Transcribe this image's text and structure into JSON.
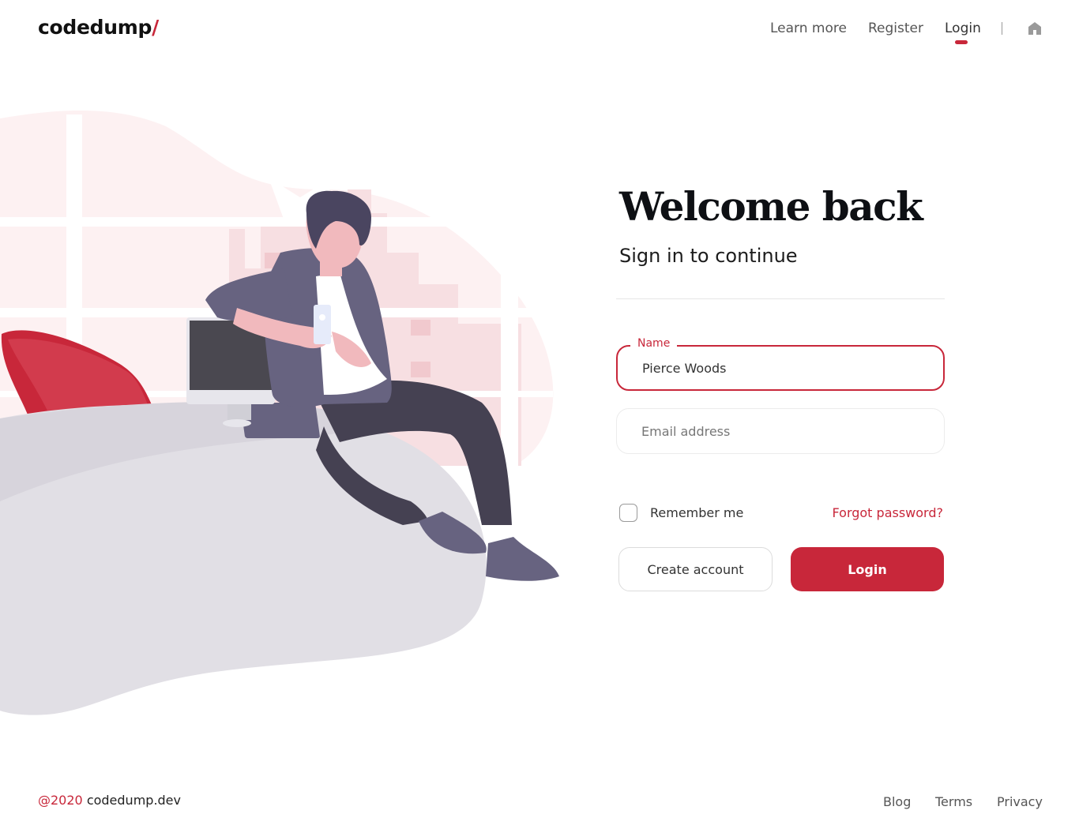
{
  "brand": {
    "name": "codedump",
    "slash": "/"
  },
  "nav": {
    "items": [
      {
        "label": "Learn more"
      },
      {
        "label": "Register"
      },
      {
        "label": "Login"
      }
    ],
    "active": "Login"
  },
  "form": {
    "title": "Welcome back",
    "subtitle": "Sign in to continue",
    "name": {
      "legend": "Name",
      "value": "Pierce Woods"
    },
    "email": {
      "placeholder": "Email address",
      "value": ""
    },
    "remember_label": "Remember me",
    "remember_checked": false,
    "forgot_label": "Forgot password?",
    "create_label": "Create account",
    "login_label": "Login"
  },
  "footer": {
    "year": "@2020",
    "site": "codedump.dev",
    "links": [
      {
        "label": "Blog"
      },
      {
        "label": "Terms"
      },
      {
        "label": "Privacy"
      }
    ]
  },
  "colors": {
    "accent": "#c8273a",
    "text": "#1c1c1c",
    "muted": "#555555",
    "illustration_pink": "#f9e4e6",
    "illustration_gray": "#e2dfe6",
    "figure_purple": "#676380"
  },
  "icons": {
    "home": "home-icon"
  }
}
